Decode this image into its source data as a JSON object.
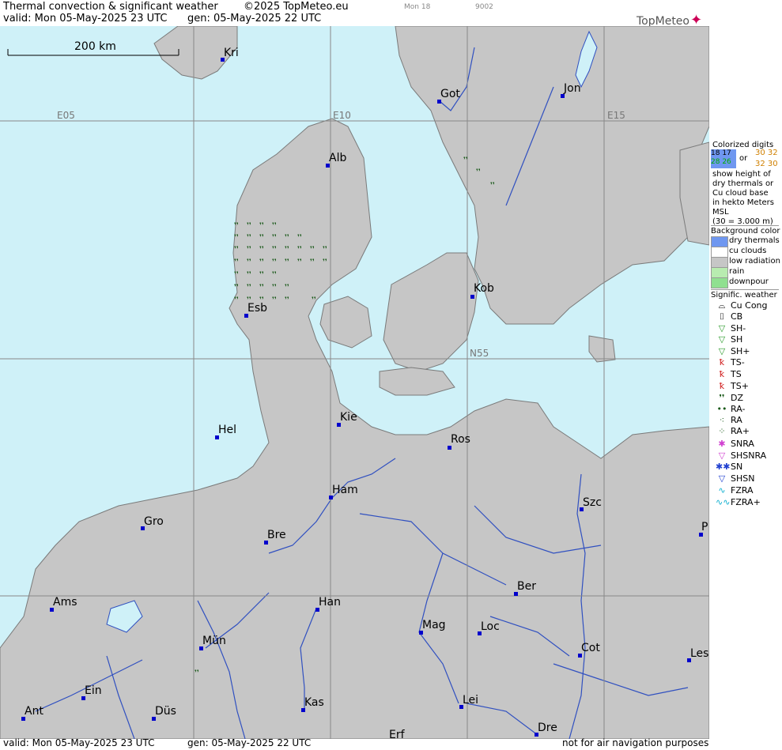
{
  "header": {
    "title": "Thermal convection & significant weather",
    "copyright": "©2025 TopMeteo.eu",
    "day_code": "Mon 18",
    "code2": "9002",
    "valid": "valid:  Mon  05-May-2025  23 UTC",
    "gen": "gen: 05-May-2025 22 UTC",
    "logo": "TopMeteo"
  },
  "footer": {
    "valid": "valid:  Mon  05-May-2025  23 UTC",
    "gen": "gen: 05-May-2025 22 UTC",
    "note": "not for air navigation purposes"
  },
  "scale": "200 km",
  "grid_labels": [
    "E05",
    "E10",
    "E15",
    "N55"
  ],
  "cities": [
    "Kri",
    "Got",
    "Jon",
    "Alb",
    "Kob",
    "Esb",
    "Kie",
    "Hel",
    "Ros",
    "Ham",
    "Szc",
    "Gro",
    "Bre",
    "Ams",
    "Han",
    "Ber",
    "Mag",
    "Loc",
    "Mün",
    "Cot",
    "Les",
    "Ein",
    "Kas",
    "Lei",
    "Ant",
    "Düs",
    "Dre",
    "Erf",
    "P"
  ],
  "legend": {
    "colorized_title": "Colorized digits",
    "digits_a1": "18 17",
    "digits_a2": "28 26",
    "or": "or",
    "digits_b1": "30 32",
    "digits_b2": "32 30",
    "desc1": "show height of",
    "desc2": "dry thermals or",
    "desc3": "Cu cloud base",
    "desc4": "in hekto Meters",
    "desc5": "MSL",
    "desc6": "(30 = 3.000 m)",
    "bg_title": "Background color",
    "bg": [
      {
        "label": "dry thermals",
        "color": "#6f97f0"
      },
      {
        "label": "cu clouds",
        "color": "#ffffff"
      },
      {
        "label": "low radiation",
        "color": "#c6c6c6"
      },
      {
        "label": "rain",
        "color": "#b8ecb0"
      },
      {
        "label": "downpour",
        "color": "#90e090"
      }
    ],
    "sig_title": "Signific. weather",
    "sig": [
      {
        "label": "Cu Cong",
        "glyph": "⌓",
        "color": "#000"
      },
      {
        "label": "CB",
        "glyph": "⌷",
        "color": "#000"
      },
      {
        "label": "SH-",
        "glyph": "▽",
        "color": "#2a9a2a"
      },
      {
        "label": "SH",
        "glyph": "▽",
        "color": "#2a9a2a"
      },
      {
        "label": "SH+",
        "glyph": "▽",
        "color": "#2a9a2a"
      },
      {
        "label": "TS-",
        "glyph": "ꝁ",
        "color": "#d02020"
      },
      {
        "label": "TS",
        "glyph": "ꝁ",
        "color": "#d02020"
      },
      {
        "label": "TS+",
        "glyph": "ꝁ",
        "color": "#d02020"
      },
      {
        "label": "DZ",
        "glyph": "❜❜",
        "color": "#1a5a1a"
      },
      {
        "label": "RA-",
        "glyph": "••",
        "color": "#1a5a1a"
      },
      {
        "label": "RA",
        "glyph": "⁖",
        "color": "#1a5a1a"
      },
      {
        "label": "RA+",
        "glyph": "⁘",
        "color": "#1a5a1a"
      },
      {
        "label": "SNRA",
        "glyph": "✱",
        "color": "#d040d0"
      },
      {
        "label": "SHSNRA",
        "glyph": "▽",
        "color": "#d040d0"
      },
      {
        "label": "SN",
        "glyph": "✱✱",
        "color": "#2040d0"
      },
      {
        "label": "SHSN",
        "glyph": "▽",
        "color": "#2040d0"
      },
      {
        "label": "FZRA",
        "glyph": "∿",
        "color": "#10b0d0"
      },
      {
        "label": "FZRA+",
        "glyph": "∿∿",
        "color": "#10b0d0"
      }
    ]
  }
}
